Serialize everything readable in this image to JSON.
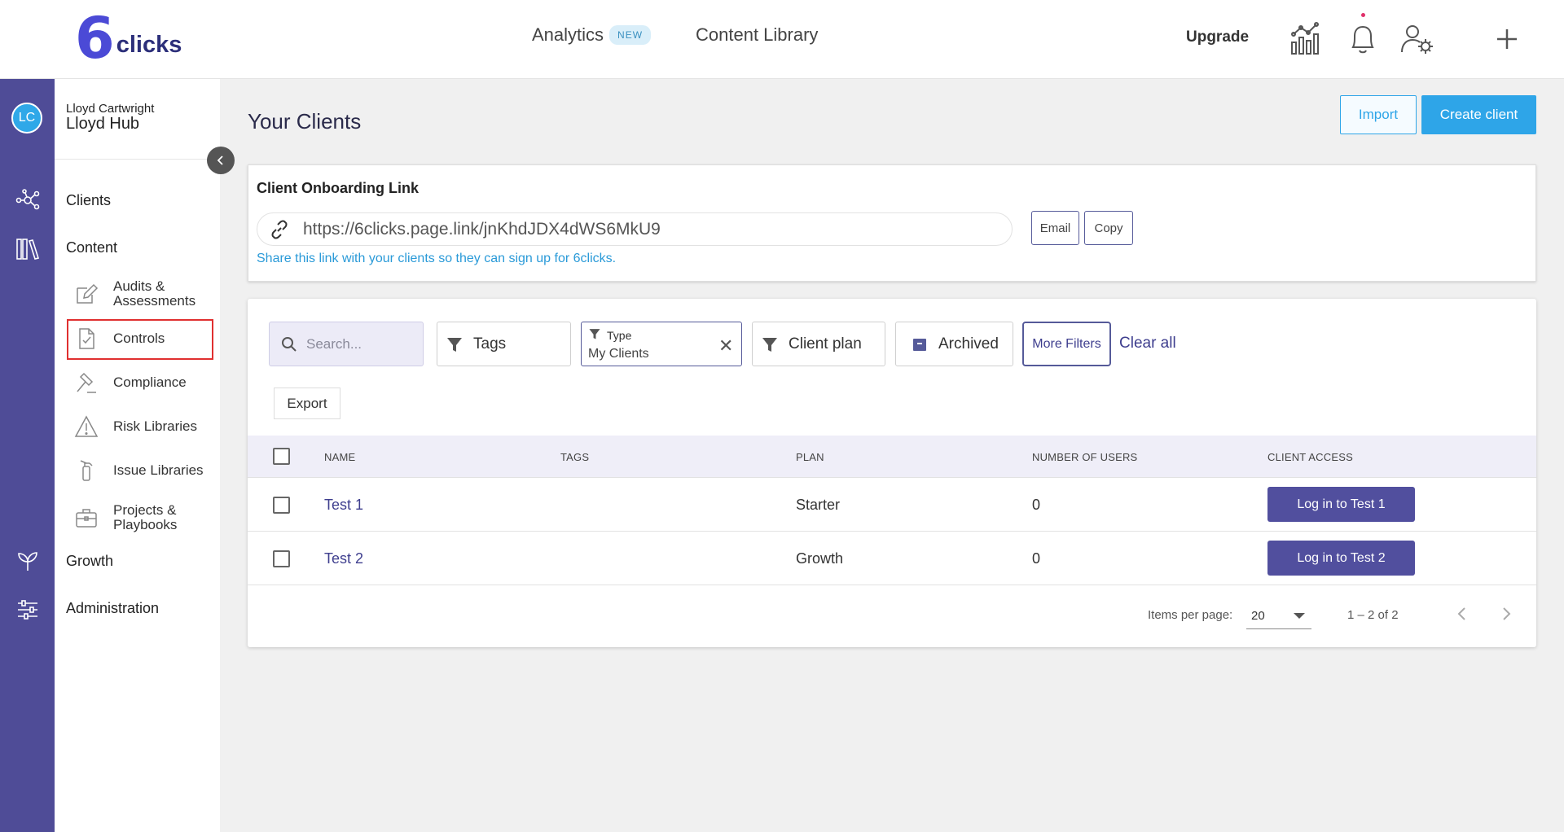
{
  "brand": {
    "logo_mark": "6",
    "logo_text": "clicks"
  },
  "topnav": {
    "analytics_label": "Analytics",
    "analytics_badge": "NEW",
    "content_library_label": "Content Library",
    "upgrade_label": "Upgrade",
    "icons": [
      "analytics-chart-icon",
      "bell-icon",
      "user-settings-icon",
      "plus-icon"
    ]
  },
  "rail": {
    "avatar_initials": "LC",
    "icons": [
      "network-icon",
      "library-icon",
      "sprout-icon",
      "sliders-icon"
    ]
  },
  "sidepanel": {
    "user_name": "Lloyd Cartwright",
    "hub_name": "Lloyd Hub",
    "clients": "Clients",
    "content": "Content",
    "audits_line1": "Audits &",
    "audits_line2": "Assessments",
    "controls": "Controls",
    "compliance": "Compliance",
    "risk_libraries": "Risk Libraries",
    "issue_libraries": "Issue Libraries",
    "projects_line1": "Projects &",
    "projects_line2": "Playbooks",
    "growth": "Growth",
    "administration": "Administration"
  },
  "main": {
    "title": "Your Clients",
    "import_label": "Import",
    "create_label": "Create client"
  },
  "onboarding": {
    "title": "Client Onboarding Link",
    "link": "https://6clicks.page.link/jnKhdJDX4dWS6MkU9",
    "email_label": "Email",
    "copy_label": "Copy",
    "helper": "Share this link with your clients so they can sign up for 6clicks."
  },
  "filters": {
    "search_placeholder": "Search...",
    "tags": "Tags",
    "type_caption": "Type",
    "type_value": "My Clients",
    "client_plan": "Client plan",
    "archived": "Archived",
    "more_filters": "More Filters",
    "clear_all": "Clear all",
    "export": "Export"
  },
  "table": {
    "columns": [
      "NAME",
      "TAGS",
      "PLAN",
      "NUMBER OF USERS",
      "CLIENT ACCESS"
    ],
    "rows": [
      {
        "name": "Test 1",
        "tags": "",
        "plan": "Starter",
        "users": "0",
        "access": "Log in to Test 1"
      },
      {
        "name": "Test 2",
        "tags": "",
        "plan": "Growth",
        "users": "0",
        "access": "Log in to Test 2"
      }
    ]
  },
  "pager": {
    "items_label": "Items per page:",
    "per_page": "20",
    "range": "1 – 2 of 2"
  },
  "colors": {
    "rail": "#4f4c97",
    "accent": "#2ea5e8",
    "primary_button": "#514f9e",
    "highlight_box": "#e03030"
  }
}
